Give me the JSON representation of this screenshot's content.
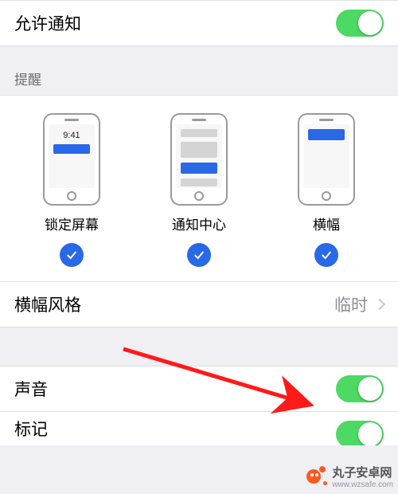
{
  "allow_notifications": {
    "label": "允许通知",
    "enabled": true
  },
  "alerts_header": "提醒",
  "previews": {
    "lock_screen": {
      "label": "锁定屏幕",
      "time": "9:41",
      "checked": true
    },
    "notification_center": {
      "label": "通知中心",
      "checked": true
    },
    "banners": {
      "label": "横幅",
      "checked": true
    }
  },
  "banner_style": {
    "label": "横幅风格",
    "value": "临时"
  },
  "sounds": {
    "label": "声音",
    "enabled": true
  },
  "badges": {
    "label": "标记",
    "enabled": true
  },
  "watermark": {
    "text": "丸子安卓网",
    "url": "www.wzsafe.com"
  }
}
